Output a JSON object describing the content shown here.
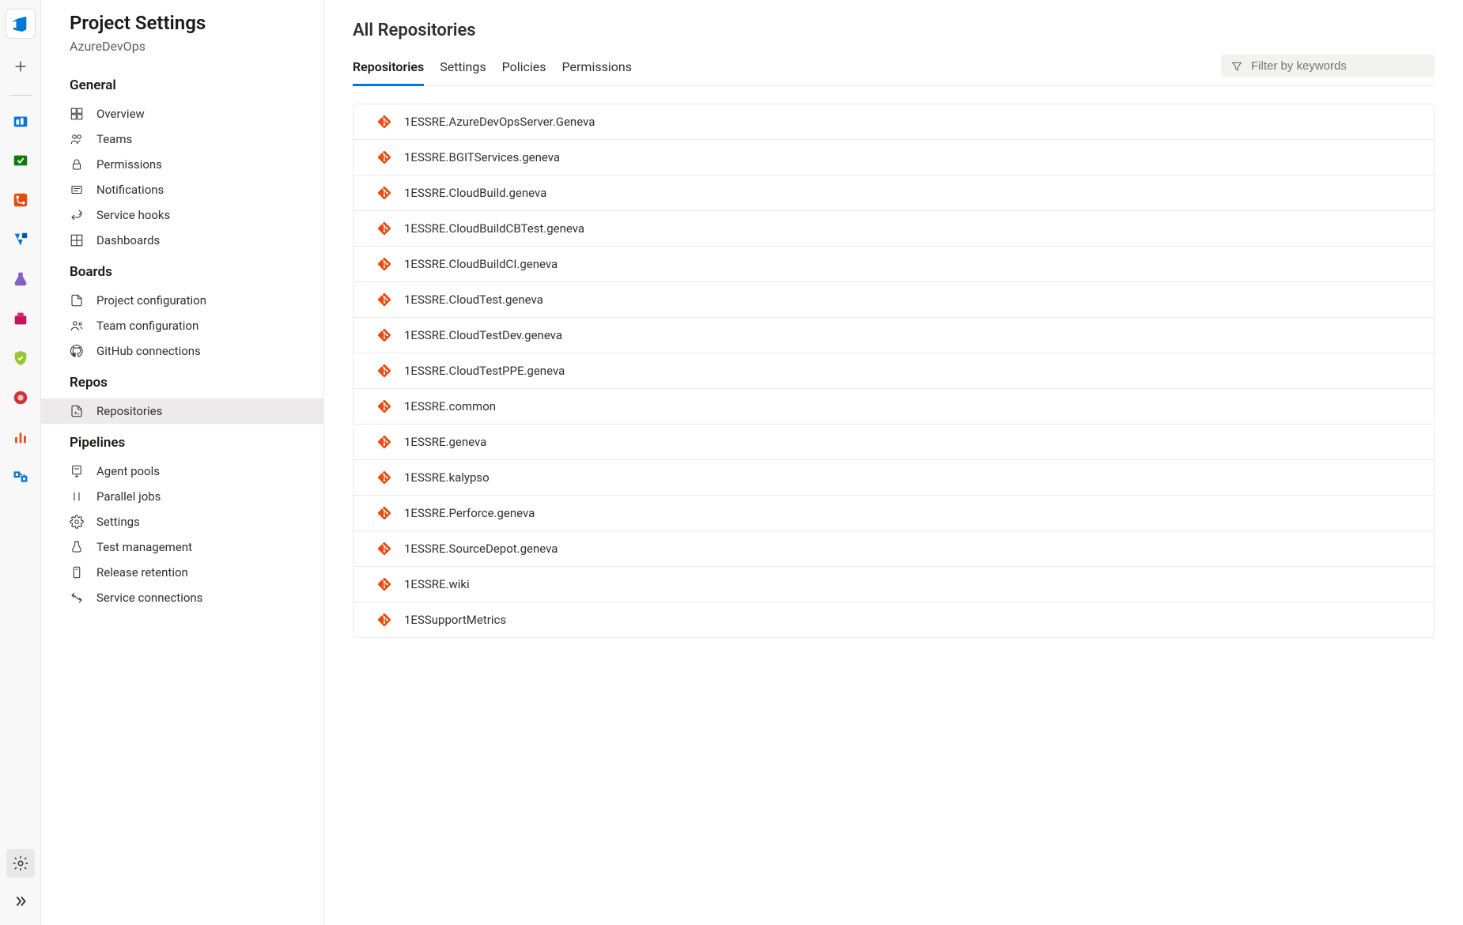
{
  "sidebar": {
    "title": "Project Settings",
    "project": "AzureDevOps",
    "sections": [
      {
        "heading": "General",
        "items": [
          {
            "key": "overview",
            "label": "Overview"
          },
          {
            "key": "teams",
            "label": "Teams"
          },
          {
            "key": "permissions",
            "label": "Permissions"
          },
          {
            "key": "notifications",
            "label": "Notifications"
          },
          {
            "key": "service-hooks",
            "label": "Service hooks"
          },
          {
            "key": "dashboards",
            "label": "Dashboards"
          }
        ]
      },
      {
        "heading": "Boards",
        "items": [
          {
            "key": "project-configuration",
            "label": "Project configuration"
          },
          {
            "key": "team-configuration",
            "label": "Team configuration"
          },
          {
            "key": "github-connections",
            "label": "GitHub connections"
          }
        ]
      },
      {
        "heading": "Repos",
        "items": [
          {
            "key": "repositories",
            "label": "Repositories",
            "active": true
          }
        ]
      },
      {
        "heading": "Pipelines",
        "items": [
          {
            "key": "agent-pools",
            "label": "Agent pools"
          },
          {
            "key": "parallel-jobs",
            "label": "Parallel jobs"
          },
          {
            "key": "settings",
            "label": "Settings"
          },
          {
            "key": "test-management",
            "label": "Test management"
          },
          {
            "key": "release-retention",
            "label": "Release retention"
          },
          {
            "key": "service-connections",
            "label": "Service connections"
          }
        ]
      }
    ]
  },
  "main": {
    "title": "All Repositories",
    "tabs": [
      {
        "label": "Repositories",
        "active": true
      },
      {
        "label": "Settings"
      },
      {
        "label": "Policies"
      },
      {
        "label": "Permissions"
      }
    ],
    "filter_placeholder": "Filter by keywords",
    "repositories": [
      {
        "name": "1ESSRE.AzureDevOpsServer.Geneva"
      },
      {
        "name": "1ESSRE.BGITServices.geneva"
      },
      {
        "name": "1ESSRE.CloudBuild.geneva"
      },
      {
        "name": "1ESSRE.CloudBuildCBTest.geneva"
      },
      {
        "name": "1ESSRE.CloudBuildCI.geneva"
      },
      {
        "name": "1ESSRE.CloudTest.geneva"
      },
      {
        "name": "1ESSRE.CloudTestDev.geneva"
      },
      {
        "name": "1ESSRE.CloudTestPPE.geneva"
      },
      {
        "name": "1ESSRE.common"
      },
      {
        "name": "1ESSRE.geneva"
      },
      {
        "name": "1ESSRE.kalypso"
      },
      {
        "name": "1ESSRE.Perforce.geneva"
      },
      {
        "name": "1ESSRE.SourceDepot.geneva"
      },
      {
        "name": "1ESSRE.wiki"
      },
      {
        "name": "1ESSupportMetrics"
      }
    ]
  }
}
